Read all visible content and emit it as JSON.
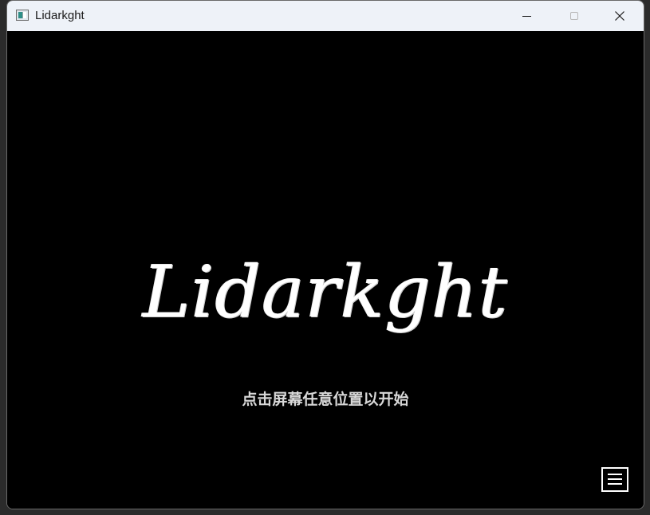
{
  "window": {
    "title": "Lidarkght"
  },
  "game": {
    "title": "Lidarkght",
    "start_hint": "点击屏幕任意位置以开始"
  },
  "icons": {
    "app": "app-window-icon",
    "minimize": "minimize-icon",
    "maximize": "maximize-icon",
    "close": "close-icon",
    "menu": "hamburger-menu-icon"
  },
  "colors": {
    "titlebar_bg": "#eef2f8",
    "game_bg": "#000000",
    "title_text": "#ffffff",
    "hint_text": "#d8d8d8"
  }
}
